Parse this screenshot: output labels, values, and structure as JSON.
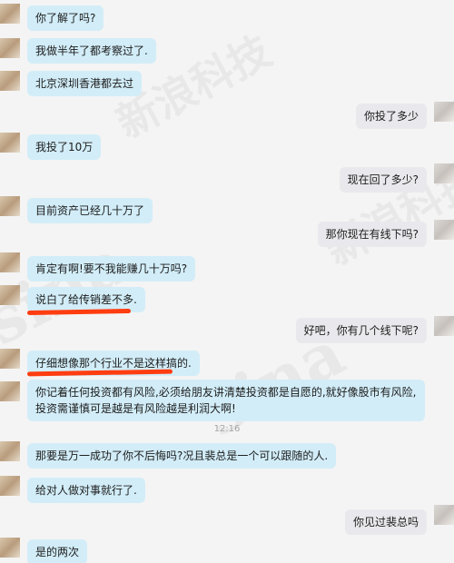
{
  "messages": [
    {
      "side": "left",
      "text": "你了解了吗?"
    },
    {
      "side": "left",
      "text": "我做半年了都考察过了."
    },
    {
      "side": "left",
      "text": "北京深圳香港都去过"
    },
    {
      "side": "right",
      "text": "你投了多少"
    },
    {
      "side": "left",
      "text": "我投了10万"
    },
    {
      "side": "right",
      "text": "现在回了多少?"
    },
    {
      "side": "left",
      "text": "目前资产已经几十万了"
    },
    {
      "side": "right",
      "text": "那你现在有线下吗?"
    },
    {
      "side": "left",
      "text": "肯定有啊!要不我能赚几十万吗?"
    },
    {
      "side": "left",
      "text": "说白了给传销差不多."
    },
    {
      "side": "right",
      "text": "好吧，你有几个线下呢?"
    },
    {
      "side": "left",
      "text": "仔细想像那个行业不是这样搞的."
    },
    {
      "side": "left",
      "text": "你记着任何投资都有风险,必须给朋友讲清楚投资都是自愿的,就好像股市有风险,投资需谨慎可是越是有风险越是利润大啊!"
    },
    {
      "side": "left",
      "text": "那要是万一成功了你不后悔吗?况且裴总是一个可以跟随的人."
    },
    {
      "side": "left",
      "text": "给对人做对事就行了."
    },
    {
      "side": "right",
      "text": "你见过裴总吗"
    },
    {
      "side": "left",
      "text": "是的两次"
    }
  ],
  "timestamp": "12:16",
  "watermark": {
    "brand": "sina",
    "text": "新浪科技"
  },
  "colors": {
    "incoming_bubble": "#d2edf8",
    "outgoing_bubble": "#e9e9ed",
    "highlight_underline": "#ff3d10"
  }
}
